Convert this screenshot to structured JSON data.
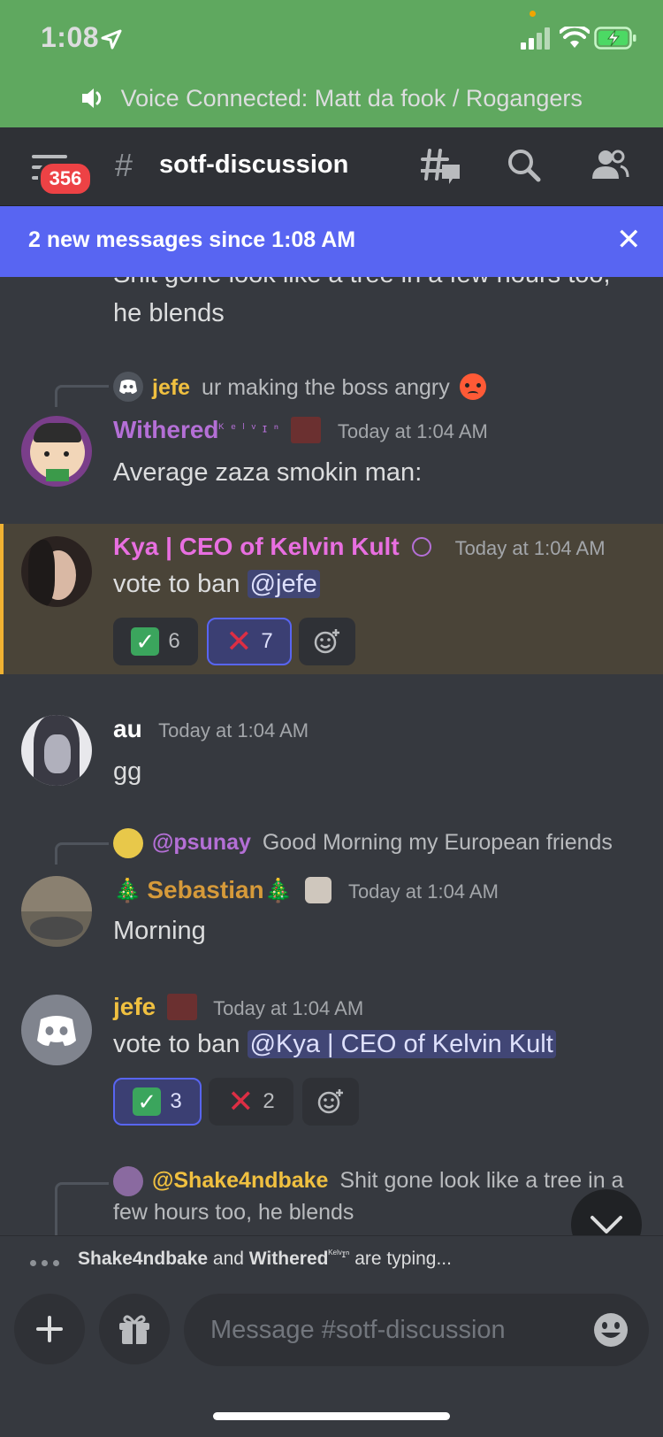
{
  "status_bar": {
    "time": "1:08"
  },
  "voice_bar": {
    "text": "Voice Connected: Matt da fook / Rogangers"
  },
  "header": {
    "badge": "356",
    "hash": "#",
    "channel": "sotf-discussion"
  },
  "new_messages": {
    "text": "2 new messages since 1:08 AM",
    "close": "✕"
  },
  "messages": {
    "top_partial": {
      "line1": "Shit gone look like a tree in a few hours too,",
      "line2": "he blends"
    },
    "withered": {
      "reply_user": "jefe",
      "reply_text": "ur making the boss angry",
      "name": "Withered",
      "name_suffix": "ᴷ ᵉ ˡ ᵛ ɪ ⁿ",
      "time": "Today at 1:04 AM",
      "text": "Average zaza smokin man:"
    },
    "kya": {
      "name": "Kya | CEO of Kelvin Kult",
      "time": "Today at 1:04 AM",
      "text_prefix": "vote to ban ",
      "mention": "@jefe",
      "reactions": [
        {
          "count": "6"
        },
        {
          "count": "7"
        }
      ]
    },
    "au": {
      "name": "au",
      "time": "Today at 1:04 AM",
      "text": "gg"
    },
    "sebastian": {
      "reply_user": "@psunay",
      "reply_text": "Good Morning my European friends",
      "name_left": "🎄",
      "name": "Sebastian",
      "name_right": "🎄",
      "time": "Today at 1:04 AM",
      "text": "Morning"
    },
    "jefe": {
      "name": "jefe",
      "time": "Today at 1:04 AM",
      "text_prefix": "vote to ban ",
      "mention": "@Kya | CEO of Kelvin Kult",
      "reactions": [
        {
          "count": "3"
        },
        {
          "count": "2"
        }
      ]
    },
    "bottom_reply": {
      "user": "@Shake4ndbake",
      "text_line1": "Shit gone look like a tree in a",
      "text_line2": "few hours too, he blends"
    }
  },
  "typing": {
    "user1": "Shake4ndbake",
    "and": " and ",
    "user2": "Withered",
    "user2_suffix": "ᴷᵉˡᵛɪⁿ",
    "suffix": " are typing..."
  },
  "composer": {
    "placeholder": "Message #sotf-discussion"
  },
  "colors": {
    "voice_green": "#5fa85f",
    "blurple": "#5865f2",
    "bg": "#36393f",
    "withered_name": "#b46fd6",
    "kya_name": "#e86fe0",
    "sebastian_name": "#d69a3a",
    "jefe_name": "#f0c040"
  }
}
